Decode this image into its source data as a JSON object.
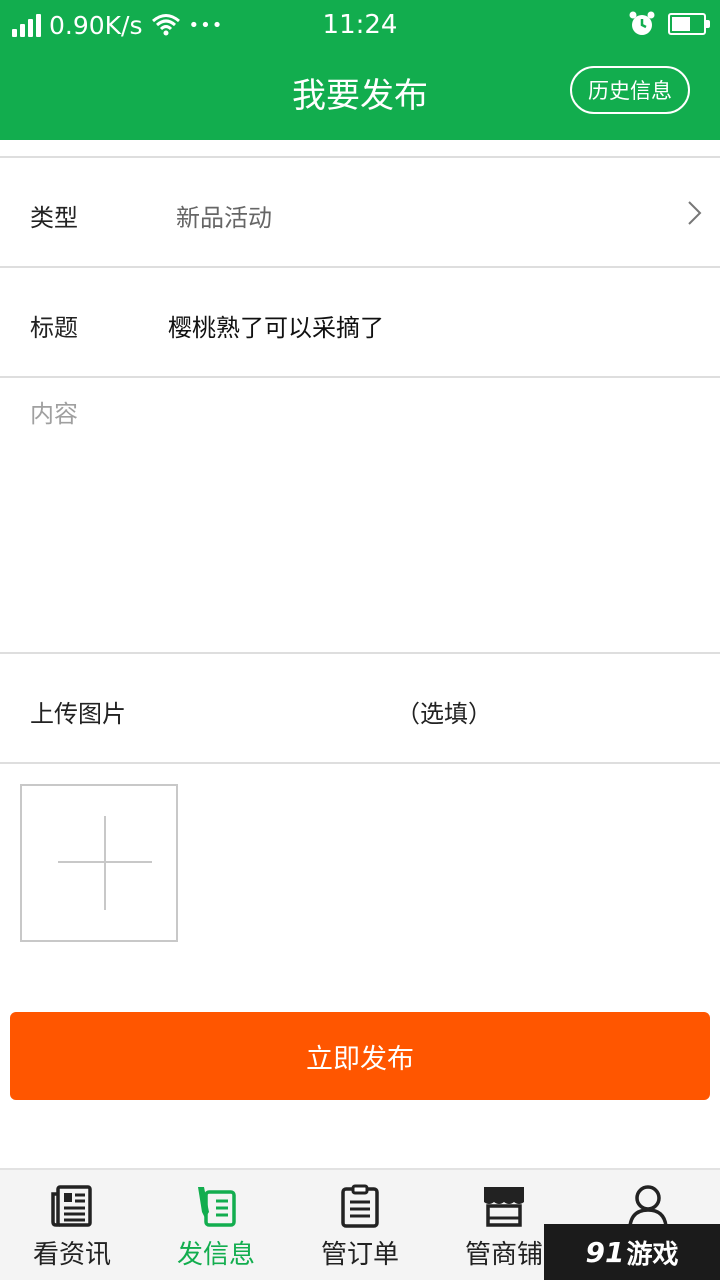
{
  "status_bar": {
    "speed": "0.90K/s",
    "dots": "•••",
    "time": "11:24",
    "battery_level": 0.6,
    "icons": [
      "signal-icon",
      "wifi-icon",
      "alarm-icon",
      "battery-icon"
    ]
  },
  "header": {
    "title": "我要发布",
    "history_label": "历史信息"
  },
  "form": {
    "type_label": "类型",
    "type_value": "新品活动",
    "title_label": "标题",
    "title_value": "樱桃熟了可以采摘了",
    "content_placeholder": "内容",
    "upload_label": "上传图片",
    "upload_hint": "（选填）"
  },
  "publish_label": "立即发布",
  "tabs": [
    {
      "label": "看资讯",
      "icon": "news-icon"
    },
    {
      "label": "发信息",
      "icon": "publish-icon",
      "active": true
    },
    {
      "label": "管订单",
      "icon": "order-list-icon"
    },
    {
      "label": "管商铺",
      "icon": "store-icon"
    },
    {
      "label": "",
      "icon": "user-icon"
    }
  ],
  "watermark": {
    "number": "91",
    "text": "游戏"
  },
  "colors": {
    "brand_green": "#12ad4e",
    "publish_orange": "#ff5600",
    "placeholder_gray": "#a0a0a0"
  }
}
